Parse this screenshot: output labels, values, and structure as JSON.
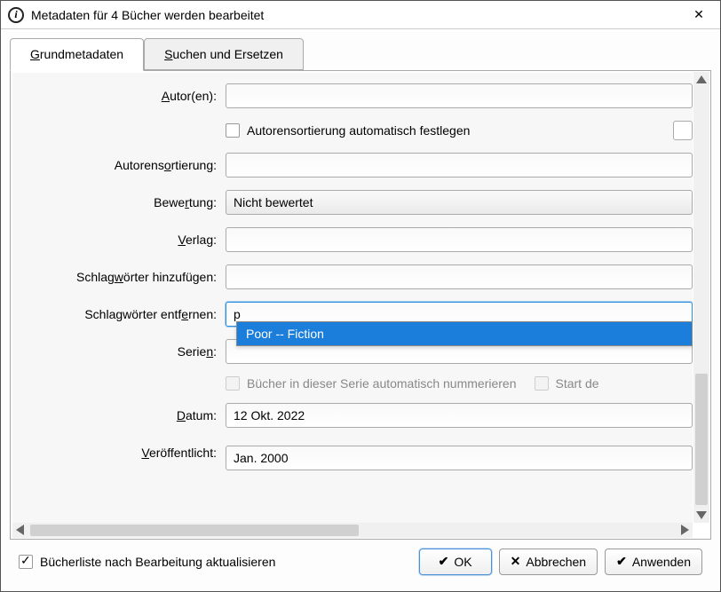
{
  "window": {
    "title": "Metadaten für 4 Bücher werden bearbeitet",
    "info_glyph": "i",
    "close_glyph": "✕"
  },
  "tabs": {
    "basic": "Grundmetadaten",
    "search_replace": "Suchen und Ersetzen"
  },
  "labels": {
    "authors": "Autor(en):",
    "author_sort_auto": "Autorensortierung automatisch festlegen",
    "author_sort": "Autorensortierung:",
    "rating": "Bewertung:",
    "publisher": "Verlag:",
    "tags_add": "Schlagwörter hinzufügen:",
    "tags_remove": "Schlagwörter entfernen:",
    "series": "Serien:",
    "series_auto": "Bücher in dieser Serie automatisch nummerieren",
    "series_start": "Start de",
    "date": "Datum:",
    "pubdate": "Veröffentlicht:"
  },
  "values": {
    "authors": "",
    "author_sort": "",
    "rating": "Nicht bewertet",
    "publisher": "",
    "tags_add": "",
    "tags_remove": "p",
    "series": "",
    "date": "12 Okt. 2022",
    "pubdate": "Jan. 2000"
  },
  "autocomplete": {
    "items": [
      "Poor -- Fiction"
    ],
    "selected_index": 0
  },
  "footer": {
    "refresh_label": "Bücherliste nach Bearbeitung aktualisieren",
    "refresh_checked": true,
    "ok_label": "OK",
    "cancel_label": "Abbrechen",
    "apply_label": "Anwenden",
    "ok_icon": "✔",
    "cancel_icon": "✕",
    "apply_icon": "✔"
  },
  "accel": {
    "tabs_basic_char": "G",
    "tabs_sr_char": "S",
    "authors_char": "A",
    "author_sort_auto_char": "u",
    "author_sort_char": "o",
    "rating_char": "r",
    "publisher_char": "V",
    "tags_add_char": "w",
    "tags_remove_char": "e",
    "series_char": "n",
    "series_auto_char": "a",
    "date_char": "D",
    "pubdate_char": "V",
    "refresh_char": "e"
  }
}
